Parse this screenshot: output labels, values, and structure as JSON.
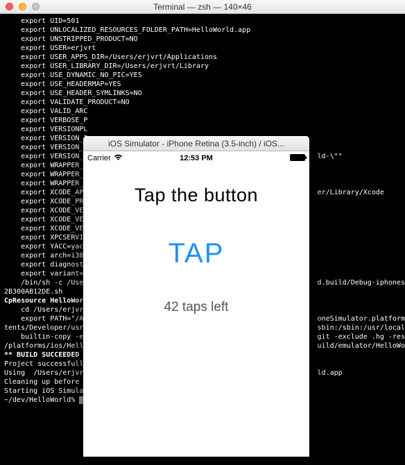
{
  "terminal": {
    "title": "Terminal — zsh — 140×46",
    "lines": [
      "    export UID=501",
      "    export UNLOCALIZED_RESOURCES_FOLDER_PATH=HelloWorld.app",
      "    export UNSTRIPPED_PRODUCT=NO",
      "    export USER=erjvrt",
      "    export USER_APPS_DIR=/Users/erjvrt/Applications",
      "    export USER_LIBRARY_DIR=/Users/erjvrt/Library",
      "    export USE_DYNAMIC_NO_PIC=YES",
      "    export USE_HEADERMAP=YES",
      "    export USE_HEADER_SYMLINKS=NO",
      "    export VALIDATE_PRODUCT=NO",
      "    export VALID_ARC",
      "    export VERBOSE_P",
      "    export VERSIONPL",
      "    export VERSION_I",
      "    export VERSION_I",
      "    export VERSION_I                                                       ld-\\\"\"",
      "    export WRAPPER_E",
      "    export WRAPPER_N",
      "    export WRAPPER_S",
      "    export XCODE_APP                                                       er/Library/Xcode",
      "    export XCODE_PRO",
      "    export XCODE_VER",
      "    export XCODE_VER",
      "    export XCODE_VER",
      "    export XPCSERVIC",
      "    export YACC=yacc",
      "    export arch=i386",
      "    export diagnosti",
      "    export variant=n",
      "    /bin/sh -c /User                                                       d.build/Debug-iphonesimu",
      "2B300AB12DE.sh",
      "",
      "CpResource HelloWorl",
      "    cd /Users/erjvrt",
      "    export PATH=\"/Ap                                                       oneSimulator.platform/De",
      "tents/Developer/usr/                                                       sbin:/sbin:/usr/local/bin",
      "    builtin-copy -ex                                                       git -exclude .hg -resolve",
      "/platforms/ios/Hello                                                       uild/emulator/HelloWorld",
      "",
      "** BUILD SUCCEEDED *",
      "",
      "Project successfully",
      "Using  /Users/erjvrt                                                       ld.app",
      "Cleaning up before s",
      "Starting iOS Simulat"
    ],
    "prompt": "~/dev/HelloWorld% "
  },
  "simulator": {
    "title": "iOS Simulator - iPhone Retina (3.5-inch) / iOS...",
    "statusbar": {
      "carrier": "Carrier",
      "time": "12:53 PM"
    },
    "app": {
      "heading": "Tap the button",
      "button": "TAP",
      "counter": "42 taps left"
    }
  }
}
